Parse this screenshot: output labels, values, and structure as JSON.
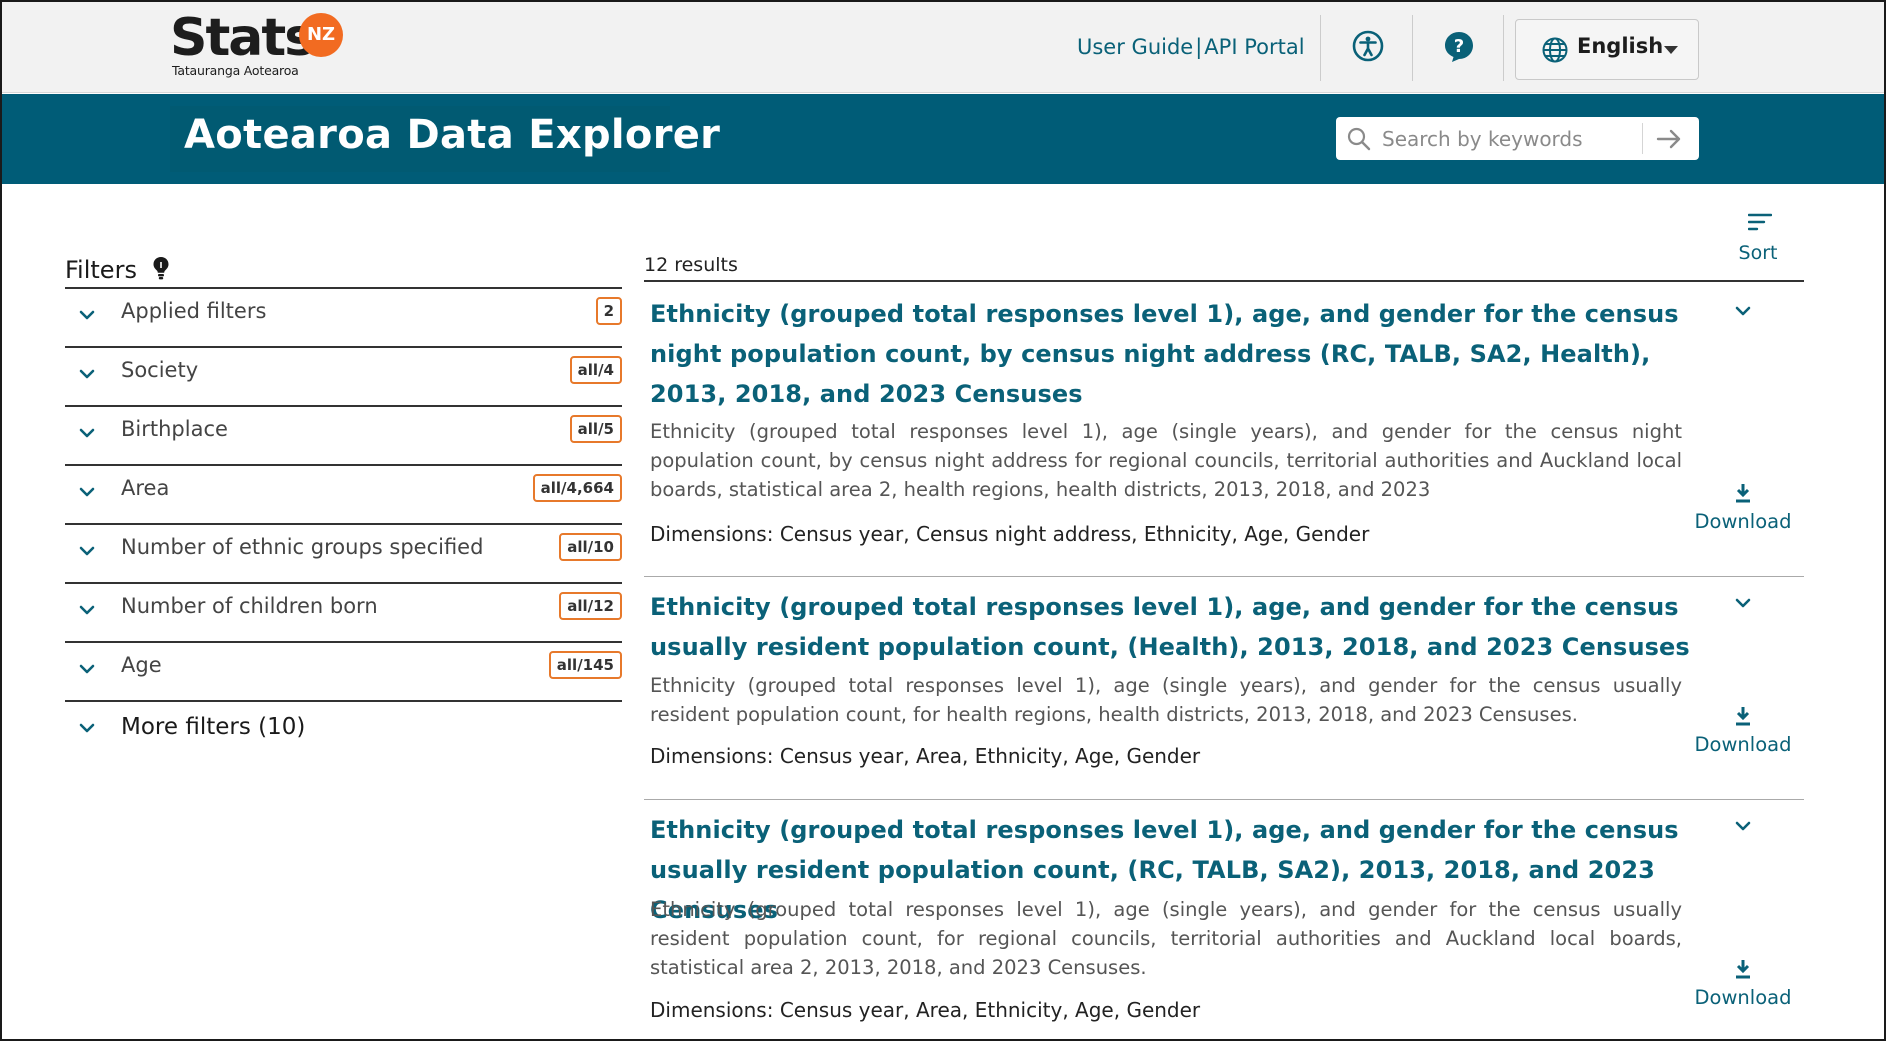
{
  "header": {
    "logo_word": "Stats",
    "logo_badge": "NZ",
    "logo_subtitle": "Tatauranga Aotearoa",
    "user_guide_label": "User Guide",
    "link_separator": "|",
    "api_portal_label": "API Portal",
    "accessibility_icon": "accessibility-icon",
    "help_icon": "help-icon",
    "language": "English"
  },
  "banner": {
    "title": "Aotearoa Data Explorer",
    "search_placeholder": "Search by keywords"
  },
  "filters": {
    "title": "Filters",
    "items": [
      {
        "label": "Applied filters",
        "badge": "2"
      },
      {
        "label": "Society",
        "badge": "all/4"
      },
      {
        "label": "Birthplace",
        "badge": "all/5"
      },
      {
        "label": "Area",
        "badge": "all/4,664"
      },
      {
        "label": "Number of ethnic groups specified",
        "badge": "all/10"
      },
      {
        "label": "Number of children born",
        "badge": "all/12"
      },
      {
        "label": "Age",
        "badge": "all/145"
      }
    ],
    "more_label": "More filters (10)"
  },
  "results": {
    "count_label": "12 results",
    "sort_label": "Sort",
    "download_label": "Download",
    "items": [
      {
        "title": "Ethnicity (grouped total responses level 1), age, and gender for the census night population count, by census night address (RC, TALB, SA2, Health), 2013, 2018, and 2023 Censuses",
        "description": "Ethnicity (grouped total responses level 1), age (single years), and gender for the census night population count, by census night address for regional councils, territorial authorities and Auckland local boards, statistical area 2, health regions, health districts, 2013, 2018, and 2023",
        "dimensions": "Dimensions: Census year, Census night address, Ethnicity, Age, Gender"
      },
      {
        "title": "Ethnicity (grouped total responses level 1), age, and gender for the census usually resident population count, (Health), 2013, 2018, and 2023 Censuses",
        "description": "Ethnicity (grouped total responses level 1), age (single years), and gender for the census usually resident population count, for health regions, health districts, 2013, 2018, and 2023 Censuses.",
        "dimensions": "Dimensions: Census year, Area, Ethnicity, Age, Gender"
      },
      {
        "title": "Ethnicity (grouped total responses level 1), age, and gender for the census usually resident population count, (RC, TALB, SA2), 2013, 2018, and 2023 Censuses",
        "description": "Ethnicity (grouped total responses level 1), age (single years), and gender for the census usually resident population count, for regional councils, territorial authorities and Auckland local boards, statistical area 2, 2013, 2018, and 2023 Censuses.",
        "dimensions": "Dimensions: Census year, Area, Ethnicity, Age, Gender"
      }
    ]
  },
  "colors": {
    "brand_teal": "#005c77",
    "link_teal": "#0a6178",
    "badge_orange": "#e7792b",
    "logo_orange": "#f26b21"
  }
}
